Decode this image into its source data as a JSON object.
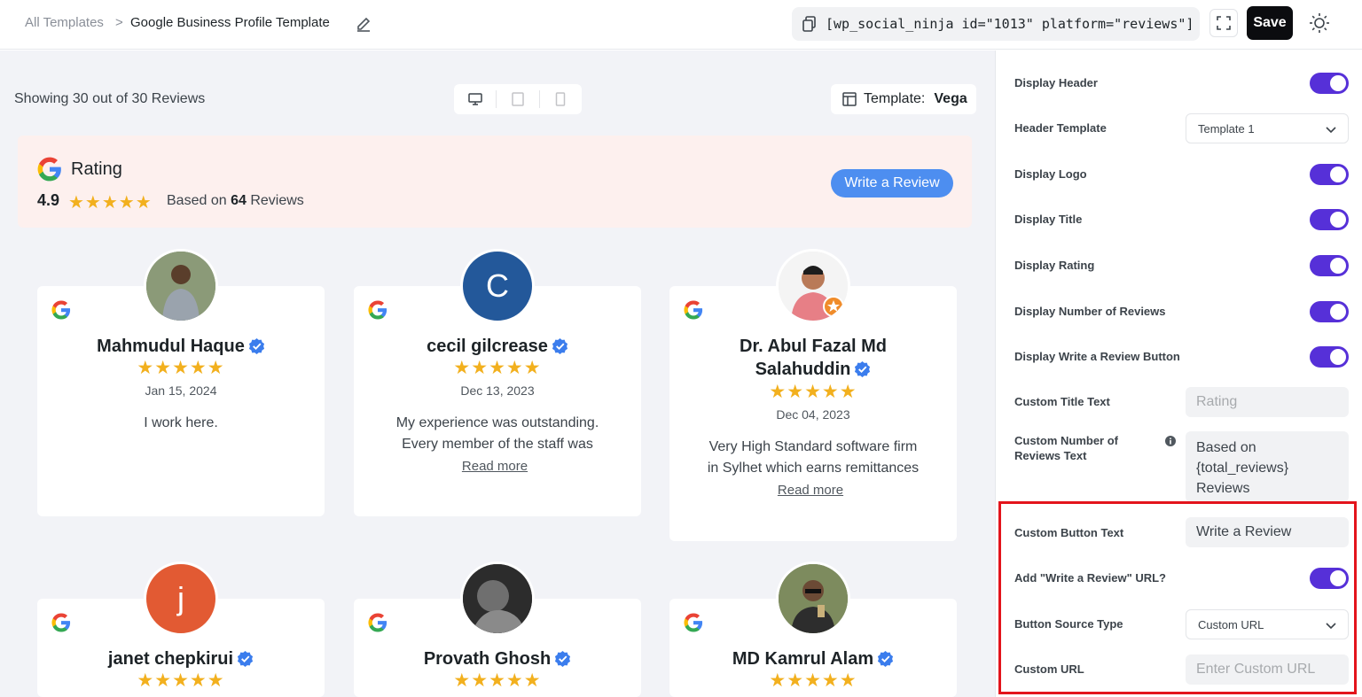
{
  "topbar": {
    "breadcrumb_link": "All Templates",
    "breadcrumb_sep": ">",
    "title": "Google Business Profile Template",
    "shortcode": "[wp_social_ninja id=\"1013\" platform=\"reviews\"]",
    "save_label": "Save",
    "icons": [
      "edit-icon",
      "copy-icon",
      "fullscreen-icon",
      "sun-icon"
    ]
  },
  "preview": {
    "showing_text": "Showing 30 out of 30 Reviews",
    "devices": [
      "desktop-icon",
      "tablet-icon",
      "mobile-icon"
    ],
    "template_label": "Template:",
    "template_value": "Vega",
    "header": {
      "title": "Rating",
      "rating": "4.9",
      "stars": "★★★★★",
      "based_prefix": "Based on",
      "count": "64",
      "based_suffix": "Reviews",
      "button": "Write a Review"
    },
    "reviews": [
      {
        "name": "Mahmudul Haque",
        "stars": "★★★★★",
        "date": "Jan 15, 2024",
        "text": "I work here.",
        "read_more": ""
      },
      {
        "name": "cecil gilcrease",
        "initial": "C",
        "stars": "★★★★★",
        "date": "Dec 13, 2023",
        "text_line1": "My experience was outstanding.",
        "text_line2": "Every member of the staff was",
        "read_more": "Read more"
      },
      {
        "name_line1": "Dr. Abul Fazal Md",
        "name_line2": "Salahuddin",
        "stars": "★★★★★",
        "date": "Dec 04, 2023",
        "text_line1": "Very High Standard software firm",
        "text_line2": "in Sylhet which earns remittances",
        "read_more": "Read more"
      },
      {
        "name": "janet chepkirui",
        "initial": "j",
        "stars": "★★★★★"
      },
      {
        "name": "Provath Ghosh",
        "stars": "★★★★★"
      },
      {
        "name": "MD Kamrul Alam",
        "stars": "★★★★★"
      }
    ]
  },
  "settings": {
    "display_header": "Display Header",
    "header_template_label": "Header Template",
    "header_template_value": "Template 1",
    "display_logo": "Display Logo",
    "display_title": "Display Title",
    "display_rating": "Display Rating",
    "display_number": "Display Number of Reviews",
    "display_write_btn": "Display Write a Review Button",
    "custom_title_label": "Custom Title Text",
    "custom_title_placeholder": "Rating",
    "custom_number_label_line1": "Custom Number of",
    "custom_number_label_line2": "Reviews Text",
    "custom_number_value_line1": "Based on",
    "custom_number_value_line2": "{total_reviews}",
    "custom_number_value_line3": "Reviews",
    "custom_button_label": "Custom Button Text",
    "custom_button_value": "Write a Review",
    "add_url_label": "Add \"Write a Review\" URL?",
    "source_type_label": "Button Source Type",
    "source_type_value": "Custom URL",
    "custom_url_label": "Custom URL",
    "custom_url_placeholder": "Enter Custom URL"
  },
  "colors": {
    "accent": "#5630d8",
    "button_blue": "#4d8ef0",
    "star": "#f2b01e",
    "highlight": "#e3141c"
  }
}
